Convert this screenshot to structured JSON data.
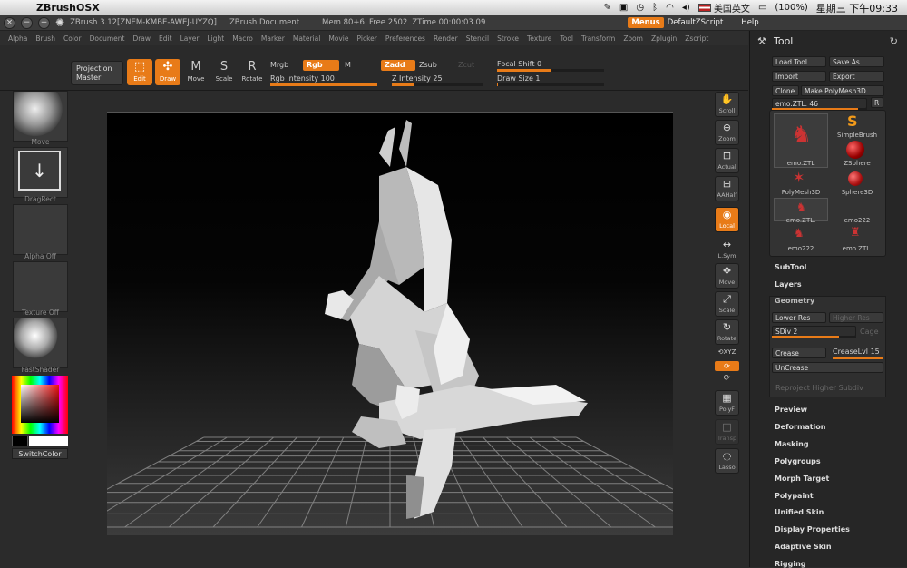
{
  "mac": {
    "app_name": "ZBrushOSX",
    "input_method": "美国英文",
    "battery": "(100%)",
    "clock": "星期三 下午09:33"
  },
  "title_bar": {
    "app_title": "ZBrush 3.12[ZNEM-KMBE-AWEJ-UYZQ]",
    "document": "ZBrush Document",
    "mem": "Mem 80+6",
    "free": "Free 2502",
    "ztime": "ZTime 00:00:03.09",
    "menus": "Menus",
    "default_zscript": "DefaultZScript",
    "help": "Help"
  },
  "menu": [
    "Alpha",
    "Brush",
    "Color",
    "Document",
    "Draw",
    "Edit",
    "Layer",
    "Light",
    "Macro",
    "Marker",
    "Material",
    "Movie",
    "Picker",
    "Preferences",
    "Render",
    "Stencil",
    "Stroke",
    "Texture",
    "Tool",
    "Transform",
    "Zoom",
    "Zplugin",
    "Zscript"
  ],
  "shelf": {
    "projection": [
      "Projection",
      "Master"
    ],
    "edit": "Edit",
    "draw": "Draw",
    "move": "Move",
    "scale": "Scale",
    "rotate": "Rotate",
    "mrgb": "Mrgb",
    "rgb": "Rgb",
    "m": "M",
    "zadd": "Zadd",
    "zsub": "Zsub",
    "zcut": "Zcut",
    "rgb_intensity": "Rgb Intensity 100",
    "z_intensity": "Z Intensity 25",
    "focal_shift": "Focal Shift 0",
    "draw_size": "Draw Size 1",
    "rgb_intensity_level": 1.0,
    "z_intensity_level": 0.25,
    "focal_shift_level": 0.5,
    "draw_size_level": 0.01
  },
  "left": {
    "move": "Move",
    "dragrect": "DragRect",
    "alpha_off": "Alpha Off",
    "texture_off": "Texture Off",
    "fastshader": "FastShader",
    "switchcolor": "SwitchColor"
  },
  "right": {
    "scroll": "Scroll",
    "zoom": "Zoom",
    "actual": "Actual",
    "aahalf": "AAHalf",
    "local": "Local",
    "lsym": "L.Sym",
    "move": "Move",
    "scale": "Scale",
    "rotate": "Rotate",
    "xyz": "XYZ",
    "polyf": "PolyF",
    "transp": "Transp",
    "lasso": "Lasso"
  },
  "tool": {
    "title": "Tool",
    "load": "Load Tool",
    "save": "Save As",
    "import": "Import",
    "export": "Export",
    "clone": "Clone",
    "make_polymesh": "Make PolyMesh3D",
    "current": "emo.ZTL. 46",
    "r": "R",
    "items": [
      "emo.ZTL",
      "SimpleBrush",
      "ZSphere",
      "PolyMesh3D",
      "Sphere3D",
      "emo.ZTL.",
      "emo222",
      "emo222",
      "emo.ZTL."
    ],
    "subtool": "SubTool",
    "layers": "Layers",
    "geometry": "Geometry",
    "lower_res": "Lower Res",
    "higher_res": "Higher Res",
    "sdiv": "SDiv 2",
    "sdiv_level": 0.8,
    "cage": "Cage",
    "crease": "Crease",
    "creaselvl": "CreaseLvl 15",
    "creaselvl_level": 1.0,
    "uncrease": "UnCrease",
    "reproject": "Reproject Higher Subdiv",
    "sections": [
      "Preview",
      "Deformation",
      "Masking",
      "Polygroups",
      "Morph Target",
      "Polypaint",
      "Unified Skin",
      "Display Properties",
      "Adaptive Skin",
      "Rigging"
    ]
  }
}
